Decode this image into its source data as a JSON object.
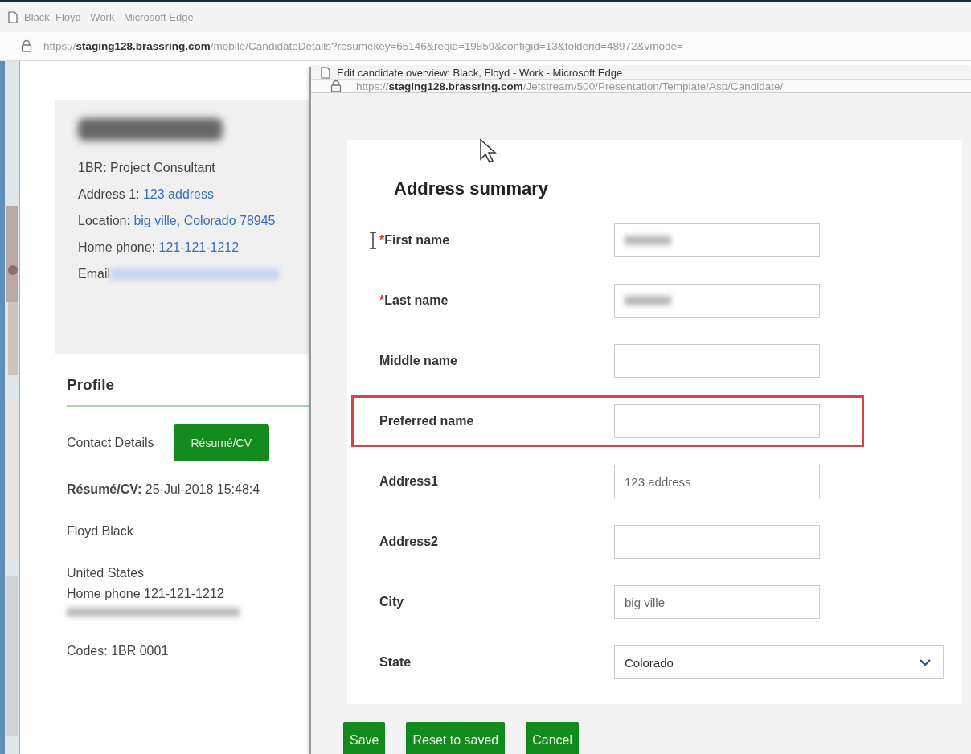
{
  "main_window": {
    "title": "Black, Floyd - Work - Microsoft Edge",
    "url_scheme": "https://",
    "url_host": "staging128.brassring.com",
    "url_path": "/mobile/CandidateDetails?resumekey=65146&reqid=19859&configid=13&folderid=48972&vmode="
  },
  "candidate": {
    "job": "1BR: Project Consultant",
    "details": [
      {
        "label": "Address 1:",
        "value": "123 address"
      },
      {
        "label": "Location:",
        "value": "big ville, Colorado 78945"
      },
      {
        "label": "Home phone:",
        "value": "121-121-1212"
      }
    ],
    "email_label": "Email"
  },
  "profile": {
    "title": "Profile",
    "tabs": [
      {
        "label": "Contact Details",
        "selected": false
      },
      {
        "label": "Résumé/CV",
        "selected": true
      }
    ],
    "resume_line": "**Résumé/CV:** 25-Jul-2018 15:48:4",
    "name": "Floyd Black",
    "country": "United States",
    "phone": "Home phone 121-121-1212",
    "codes": "Codes: 1BR 0001"
  },
  "popup": {
    "title": "Edit candidate overview: Black, Floyd - Work - Microsoft Edge",
    "url_scheme": "https://",
    "url_host": "staging128.brassring.com",
    "url_path": "/Jetstream/500/Presentation/Template/Asp/Candidate/"
  },
  "form": {
    "heading": "Address summary",
    "fields": [
      {
        "label": "First name",
        "required_mark": "*",
        "kind": "text",
        "blurred": true,
        "highlighted": false
      },
      {
        "label": "Last name",
        "required_mark": "*",
        "kind": "text",
        "blurred": true,
        "highlighted": false
      },
      {
        "label": "Middle name",
        "kind": "text",
        "blurred": false,
        "highlighted": false
      },
      {
        "label": "Preferred name",
        "kind": "text",
        "blurred": false,
        "highlighted": true
      },
      {
        "label": "Address1",
        "kind": "text",
        "value": "123 address",
        "blurred": false,
        "highlighted": false
      },
      {
        "label": "Address2",
        "kind": "text",
        "blurred": false,
        "highlighted": false
      },
      {
        "label": "City",
        "kind": "text",
        "value": "big ville",
        "blurred": false,
        "highlighted": false
      },
      {
        "label": "State",
        "kind": "select",
        "value": "Colorado",
        "highlighted": false
      }
    ]
  },
  "buttons": [
    "Save",
    "Reset to saved",
    "Cancel"
  ]
}
